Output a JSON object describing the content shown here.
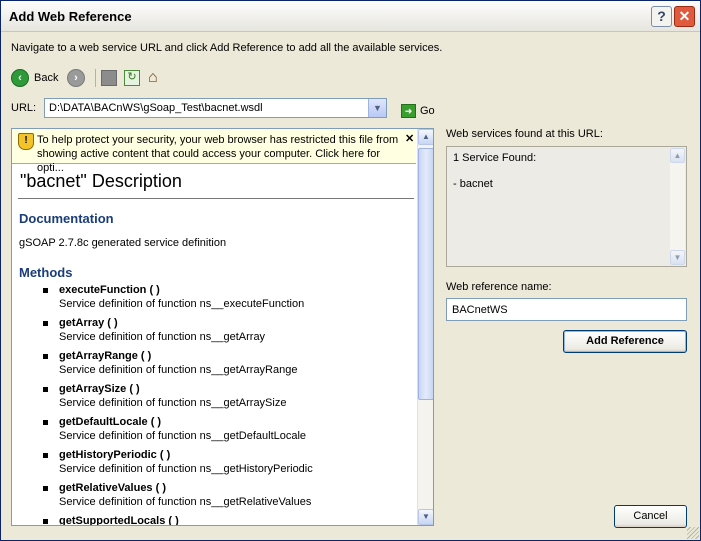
{
  "window": {
    "title": "Add Web Reference",
    "help_label": "?",
    "close_label": "✕"
  },
  "instruction": "Navigate to a web service URL and click Add Reference to add all the available services.",
  "toolbar": {
    "back_label": "Back",
    "back_icon": "‹",
    "forward_icon": "›",
    "refresh_icon": "↻",
    "home_icon": "⌂"
  },
  "url": {
    "label": "URL:",
    "value": "D:\\DATA\\BACnWS\\gSoap_Test\\bacnet.wsdl",
    "dropdown_icon": "▼",
    "go_label": "Go",
    "go_icon": "➜"
  },
  "infobar": {
    "icon": "!",
    "text": "To help protect your security, your web browser has restricted this file from showing active content that could access your computer. Click here for opti...",
    "close_icon": "✕"
  },
  "page": {
    "description_title": "\"bacnet\" Description",
    "documentation_heading": "Documentation",
    "documentation_text": "gSOAP 2.7.8c generated service definition",
    "methods_heading": "Methods",
    "methods": [
      {
        "name": "executeFunction",
        "parens": " ( )",
        "desc": "Service definition of function ns__executeFunction"
      },
      {
        "name": "getArray",
        "parens": " ( )",
        "desc": "Service definition of function ns__getArray"
      },
      {
        "name": "getArrayRange",
        "parens": " ( )",
        "desc": "Service definition of function ns__getArrayRange"
      },
      {
        "name": "getArraySize",
        "parens": " ( )",
        "desc": "Service definition of function ns__getArraySize"
      },
      {
        "name": "getDefaultLocale",
        "parens": " ( )",
        "desc": "Service definition of function ns__getDefaultLocale"
      },
      {
        "name": "getHistoryPeriodic",
        "parens": " ( )",
        "desc": "Service definition of function ns__getHistoryPeriodic"
      },
      {
        "name": "getRelativeValues",
        "parens": " ( )",
        "desc": "Service definition of function ns__getRelativeValues"
      },
      {
        "name": "getSupportedLocals",
        "parens": " ( )",
        "desc": ""
      }
    ],
    "scroll_up_icon": "▲",
    "scroll_down_icon": "▼"
  },
  "services": {
    "label": "Web services found at this URL:",
    "count_text": "1 Service Found:",
    "item_text": "- bacnet"
  },
  "reference": {
    "label": "Web reference name:",
    "value": "BACnetWS",
    "add_button": "Add Reference"
  },
  "cancel_button": "Cancel"
}
